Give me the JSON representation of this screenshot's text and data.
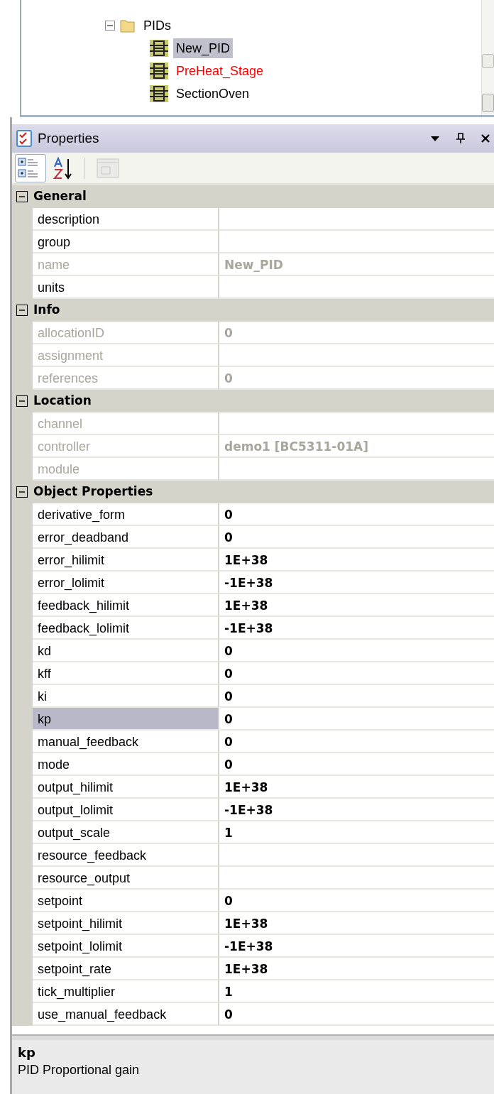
{
  "tree": {
    "items": [
      {
        "label": "PIDs",
        "kind": "folder",
        "expanded": true,
        "selected": false,
        "color": "#000000",
        "children": [
          {
            "label": "New_PID",
            "kind": "pid",
            "selected": true,
            "color": "#000000"
          },
          {
            "label": "PreHeat_Stage",
            "kind": "pid",
            "selected": false,
            "color": "#ff0000"
          },
          {
            "label": "SectionOven",
            "kind": "pid",
            "selected": false,
            "color": "#000000"
          }
        ]
      }
    ]
  },
  "panel": {
    "title": "Properties"
  },
  "toolbar": [
    {
      "kind": "categorized",
      "selected": true,
      "disabled": false
    },
    {
      "kind": "alphabetical",
      "selected": false,
      "disabled": false
    },
    {
      "kind": "pages",
      "selected": false,
      "disabled": true
    }
  ],
  "categories": [
    {
      "name": "General",
      "expanded": true,
      "properties": [
        {
          "name": "description",
          "disabled": false,
          "selected": false
        },
        {
          "name": "group",
          "disabled": false,
          "selected": false
        },
        {
          "name": "name",
          "value": "New_PID",
          "disabled": true,
          "selected": false
        },
        {
          "name": "units",
          "disabled": false,
          "selected": false
        }
      ]
    },
    {
      "name": "Info",
      "expanded": true,
      "properties": [
        {
          "name": "allocationID",
          "value": "0",
          "disabled": true,
          "selected": false
        },
        {
          "name": "assignment",
          "disabled": true,
          "selected": false
        },
        {
          "name": "references",
          "value": "0",
          "disabled": true,
          "selected": false
        }
      ]
    },
    {
      "name": "Location",
      "expanded": true,
      "properties": [
        {
          "name": "channel",
          "disabled": true,
          "selected": false
        },
        {
          "name": "controller",
          "value": "demo1 [BC5311-01A]",
          "disabled": true,
          "selected": false
        },
        {
          "name": "module",
          "disabled": true,
          "selected": false
        }
      ]
    },
    {
      "name": "Object Properties",
      "expanded": true,
      "properties": [
        {
          "name": "derivative_form",
          "value": "0",
          "disabled": false,
          "selected": false
        },
        {
          "name": "error_deadband",
          "value": "0",
          "disabled": false,
          "selected": false
        },
        {
          "name": "error_hilimit",
          "value": "1E+38",
          "disabled": false,
          "selected": false
        },
        {
          "name": "error_lolimit",
          "value": "-1E+38",
          "disabled": false,
          "selected": false
        },
        {
          "name": "feedback_hilimit",
          "value": "1E+38",
          "disabled": false,
          "selected": false
        },
        {
          "name": "feedback_lolimit",
          "value": "-1E+38",
          "disabled": false,
          "selected": false
        },
        {
          "name": "kd",
          "value": "0",
          "disabled": false,
          "selected": false
        },
        {
          "name": "kff",
          "value": "0",
          "disabled": false,
          "selected": false
        },
        {
          "name": "ki",
          "value": "0",
          "disabled": false,
          "selected": false
        },
        {
          "name": "kp",
          "value": "0",
          "disabled": false,
          "selected": true
        },
        {
          "name": "manual_feedback",
          "value": "0",
          "disabled": false,
          "selected": false
        },
        {
          "name": "mode",
          "value": "0",
          "disabled": false,
          "selected": false
        },
        {
          "name": "output_hilimit",
          "value": "1E+38",
          "disabled": false,
          "selected": false
        },
        {
          "name": "output_lolimit",
          "value": "-1E+38",
          "disabled": false,
          "selected": false
        },
        {
          "name": "output_scale",
          "value": "1",
          "disabled": false,
          "selected": false
        },
        {
          "name": "resource_feedback",
          "disabled": false,
          "selected": false
        },
        {
          "name": "resource_output",
          "disabled": false,
          "selected": false
        },
        {
          "name": "setpoint",
          "value": "0",
          "disabled": false,
          "selected": false
        },
        {
          "name": "setpoint_hilimit",
          "value": "1E+38",
          "disabled": false,
          "selected": false
        },
        {
          "name": "setpoint_lolimit",
          "value": "-1E+38",
          "disabled": false,
          "selected": false
        },
        {
          "name": "setpoint_rate",
          "value": "1E+38",
          "disabled": false,
          "selected": false
        },
        {
          "name": "tick_multiplier",
          "value": "1",
          "disabled": false,
          "selected": false
        },
        {
          "name": "use_manual_feedback",
          "value": "0",
          "disabled": false,
          "selected": false
        }
      ]
    }
  ],
  "description": {
    "title": "kp",
    "text": "PID Proportional gain"
  }
}
